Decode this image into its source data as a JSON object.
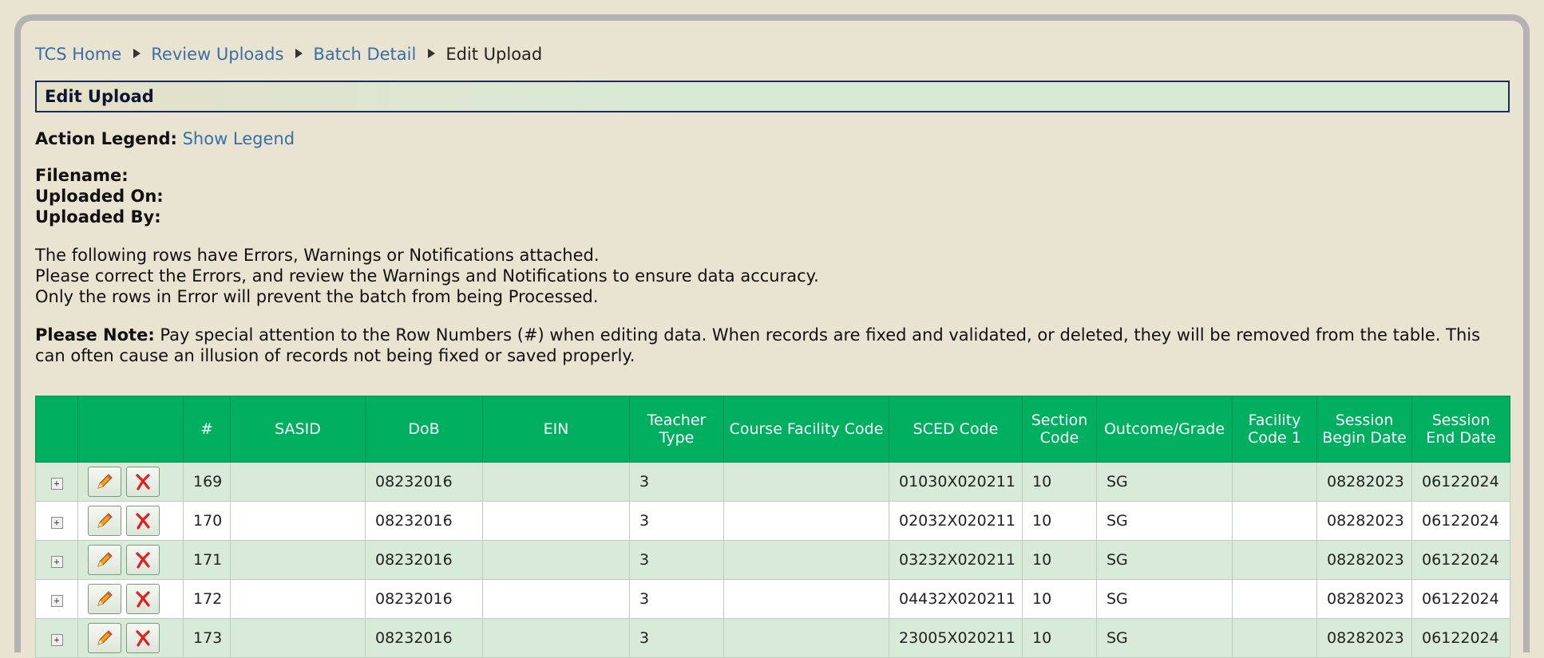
{
  "breadcrumb": {
    "items": [
      "TCS Home",
      "Review Uploads",
      "Batch Detail"
    ],
    "current": "Edit Upload"
  },
  "title": "Edit Upload",
  "legend": {
    "label": "Action Legend:",
    "link": "Show Legend"
  },
  "meta": {
    "filename_label": "Filename:",
    "uploaded_on_label": "Uploaded On:",
    "uploaded_by_label": "Uploaded By:"
  },
  "messages": [
    "The following rows have Errors, Warnings or Notifications attached.",
    "Please correct the Errors, and review the Warnings and Notifications to ensure data accuracy.",
    "Only the rows in Error will prevent the batch from being Processed."
  ],
  "note": {
    "label": "Please Note:",
    "text": " Pay special attention to the Row Numbers (#) when editing data. When records are fixed and validated, or deleted, they will be removed from the table. This can often cause an illusion of records not being fixed or saved properly."
  },
  "table": {
    "headers": [
      "",
      "",
      "#",
      "SASID",
      "DoB",
      "EIN",
      "Teacher Type",
      "Course Facility Code",
      "SCED Code",
      "Section Code",
      "Outcome/Grade",
      "Facility Code 1",
      "Session Begin Date",
      "Session End Date"
    ],
    "rows": [
      {
        "num": "169",
        "sasid": "",
        "dob": "08232016",
        "ein": "",
        "teacher_type": "3",
        "course_facility": "",
        "sced": "01030X020211",
        "section": "10",
        "outcome": "SG",
        "facility1": "",
        "begin": "08282023",
        "end": "06122024"
      },
      {
        "num": "170",
        "sasid": "",
        "dob": "08232016",
        "ein": "",
        "teacher_type": "3",
        "course_facility": "",
        "sced": "02032X020211",
        "section": "10",
        "outcome": "SG",
        "facility1": "",
        "begin": "08282023",
        "end": "06122024"
      },
      {
        "num": "171",
        "sasid": "",
        "dob": "08232016",
        "ein": "",
        "teacher_type": "3",
        "course_facility": "",
        "sced": "03232X020211",
        "section": "10",
        "outcome": "SG",
        "facility1": "",
        "begin": "08282023",
        "end": "06122024"
      },
      {
        "num": "172",
        "sasid": "",
        "dob": "08232016",
        "ein": "",
        "teacher_type": "3",
        "course_facility": "",
        "sced": "04432X020211",
        "section": "10",
        "outcome": "SG",
        "facility1": "",
        "begin": "08282023",
        "end": "06122024"
      },
      {
        "num": "173",
        "sasid": "",
        "dob": "08232016",
        "ein": "",
        "teacher_type": "3",
        "course_facility": "",
        "sced": "23005X020211",
        "section": "10",
        "outcome": "SG",
        "facility1": "",
        "begin": "08282023",
        "end": "06122024"
      }
    ],
    "expand_glyph": "+",
    "edit_icon": "pencil-icon",
    "delete_icon": "delete-x-icon"
  },
  "colors": {
    "header_green": "#00b060",
    "row_alt": "#d8ead8",
    "link": "#3a6ea5",
    "page_bg": "#e8e4d1"
  }
}
